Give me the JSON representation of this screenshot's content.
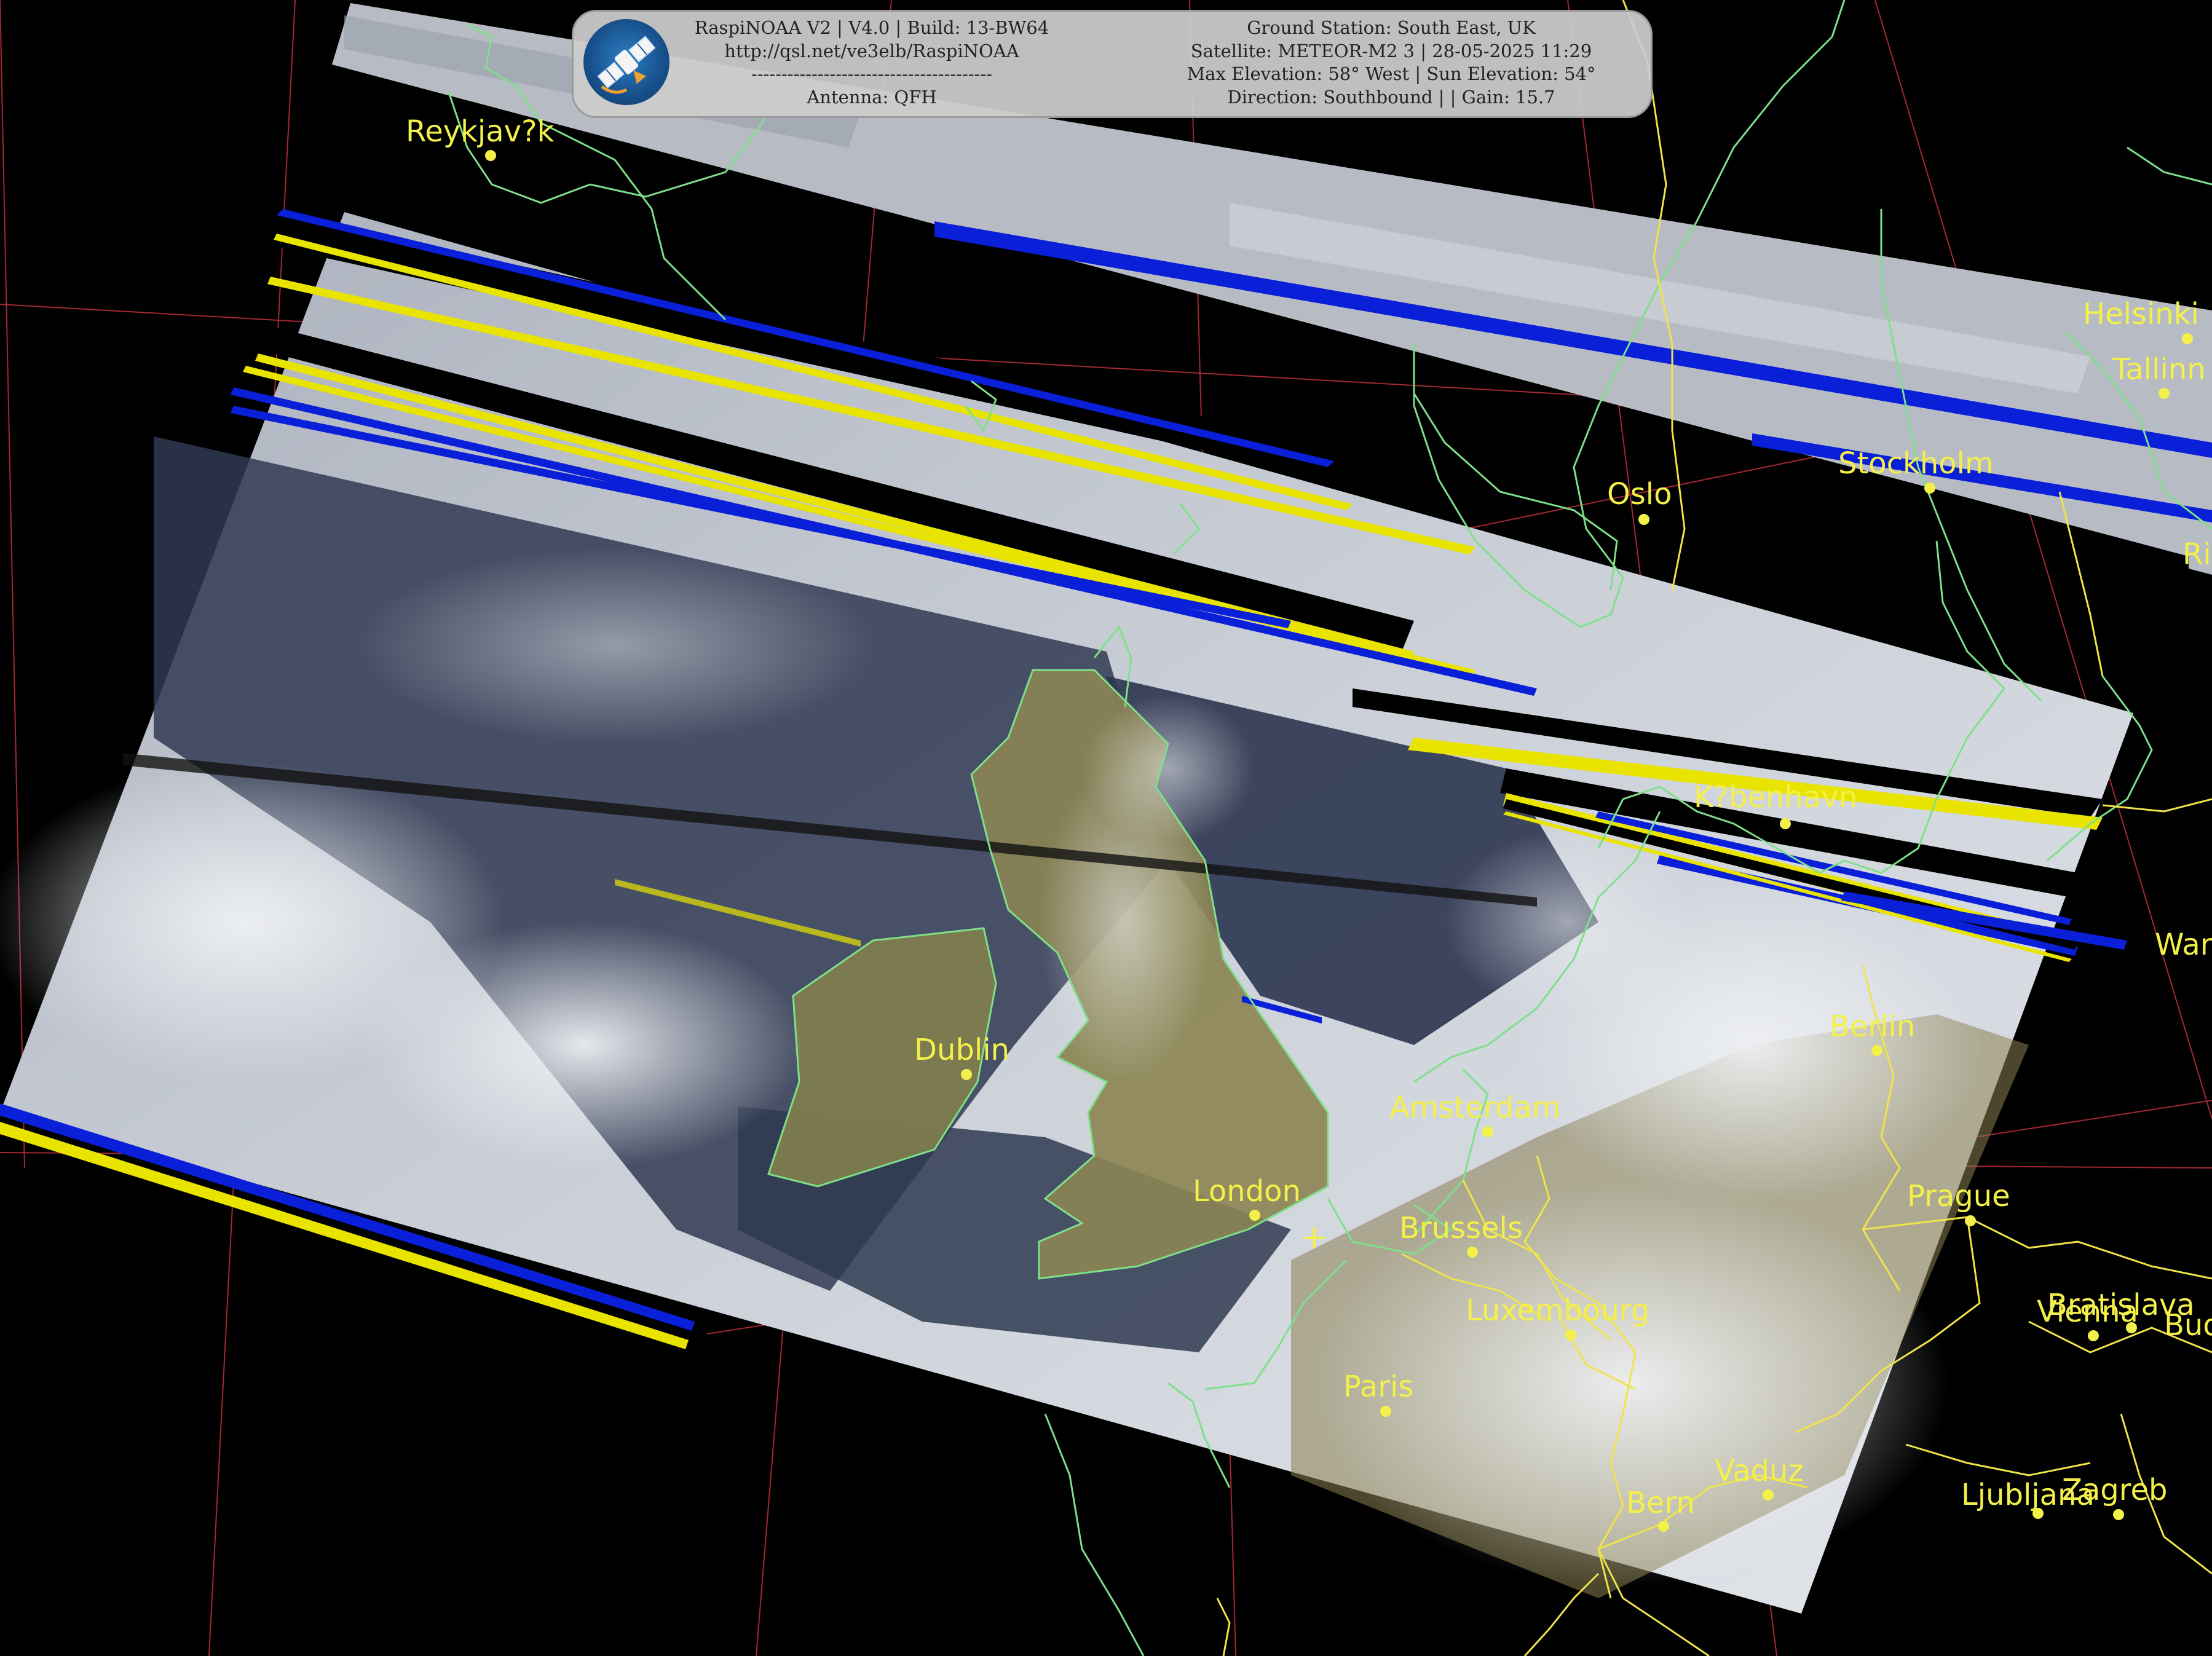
{
  "header": {
    "software_line": "RaspiNOAA V2 | V4.0 | Build: 13-BW64",
    "url_line": "http://qsl.net/ve3elb/RaspiNOAA",
    "separator_line": "----------------------------------------",
    "antenna_line": "Antenna: QFH",
    "station_line": "Ground Station: South East, UK",
    "satellite_line": "Satellite: METEOR-M2 3 | 28-05-2025 11:29",
    "elevation_line": "Max Elevation: 58° West | Sun Elevation: 54°",
    "direction_line": "Direction: Southbound | | Gain: 15.7"
  },
  "logo_icon": "satellite-icon",
  "colors": {
    "city_label": "#f4f04a",
    "coastline": "#7ee08a",
    "borders": "#f0e44a",
    "graticule": "#c0303a",
    "scan_blue": "#0a1fd8",
    "scan_yellow": "#e8e400",
    "cloud": "#d8dde2",
    "sea": "#30384c",
    "land": "#8a8450"
  },
  "ground_station_marker": "+",
  "cities": [
    {
      "id": "reykjavik",
      "label": "Reykjav?k"
    },
    {
      "id": "helsinki",
      "label": "Helsinki"
    },
    {
      "id": "tallinn",
      "label": "Tallinn"
    },
    {
      "id": "stockholm",
      "label": "Stockholm"
    },
    {
      "id": "oslo",
      "label": "Oslo"
    },
    {
      "id": "riga",
      "label": "Ri"
    },
    {
      "id": "kobenhavn",
      "label": "K?benhavn"
    },
    {
      "id": "warsaw",
      "label": "War"
    },
    {
      "id": "berlin",
      "label": "Berlin"
    },
    {
      "id": "dublin",
      "label": "Dublin"
    },
    {
      "id": "amsterdam",
      "label": "Amsterdam"
    },
    {
      "id": "london",
      "label": "London"
    },
    {
      "id": "prague",
      "label": "Prague"
    },
    {
      "id": "brussels",
      "label": "Brussels"
    },
    {
      "id": "bratislava",
      "label": "Bratislava"
    },
    {
      "id": "vienna",
      "label": "Vienna"
    },
    {
      "id": "budapest",
      "label": "Bud"
    },
    {
      "id": "luxembourg",
      "label": "Luxembourg"
    },
    {
      "id": "paris",
      "label": "Paris"
    },
    {
      "id": "vaduz",
      "label": "Vaduz"
    },
    {
      "id": "bern",
      "label": "Bern"
    },
    {
      "id": "ljubljana",
      "label": "Ljubljana"
    },
    {
      "id": "zagreb",
      "label": "Zagreb"
    }
  ]
}
